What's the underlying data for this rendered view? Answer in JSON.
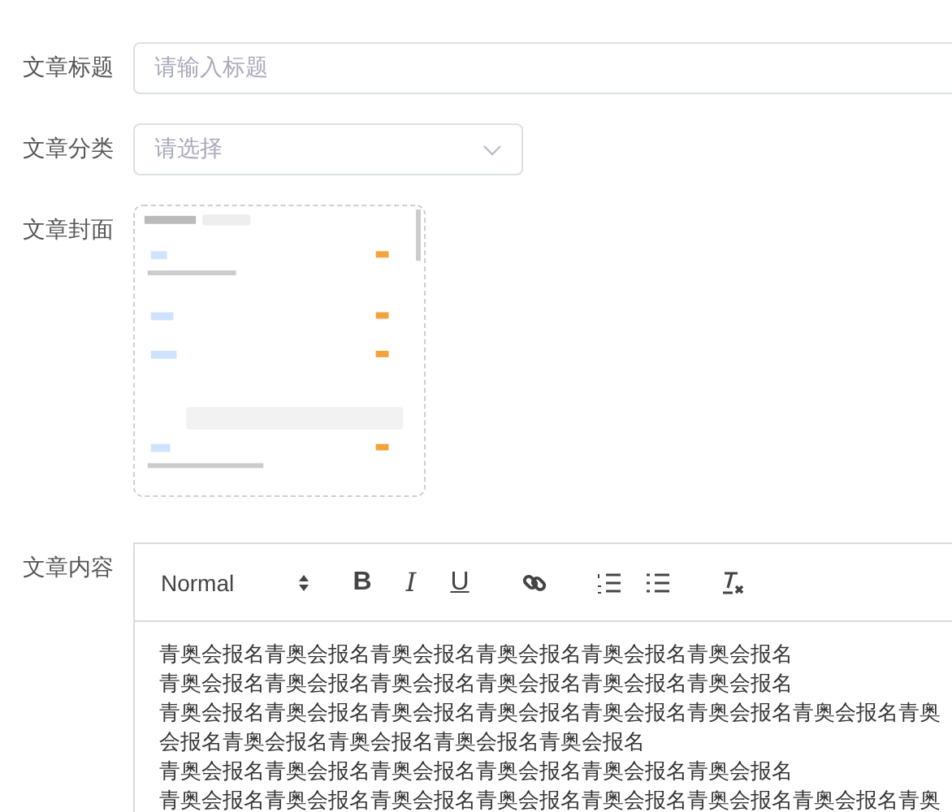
{
  "form": [
    {
      "kind": "input",
      "label": "文章标题",
      "placeholder": "请输入标题"
    },
    {
      "kind": "select",
      "label": "文章分类",
      "placeholder": "请选择"
    },
    {
      "kind": "cover",
      "label": "文章封面"
    },
    {
      "kind": "editor",
      "label": "文章内容",
      "editor": {
        "header": "Normal",
        "buttons": [
          {
            "kind": "bold",
            "label": "B"
          },
          {
            "kind": "italic",
            "label": "I"
          },
          {
            "kind": "underline",
            "label": "U"
          },
          {
            "kind": "link"
          },
          {
            "kind": "ordered-list"
          },
          {
            "kind": "bullet-list"
          },
          {
            "kind": "clean"
          }
        ],
        "paragraphs": [
          "青奥会报名青奥会报名青奥会报名青奥会报名青奥会报名青奥会报名",
          "青奥会报名青奥会报名青奥会报名青奥会报名青奥会报名青奥会报名",
          "青奥会报名青奥会报名青奥会报名青奥会报名青奥会报名青奥会报名青奥会报名青奥会报名青奥会报名青奥会报名青奥会报名青奥会报名",
          "青奥会报名青奥会报名青奥会报名青奥会报名青奥会报名青奥会报名",
          "青奥会报名青奥会报名青奥会报名青奥会报名青奥会报名青奥会报名青奥会报名青奥"
        ]
      }
    }
  ]
}
